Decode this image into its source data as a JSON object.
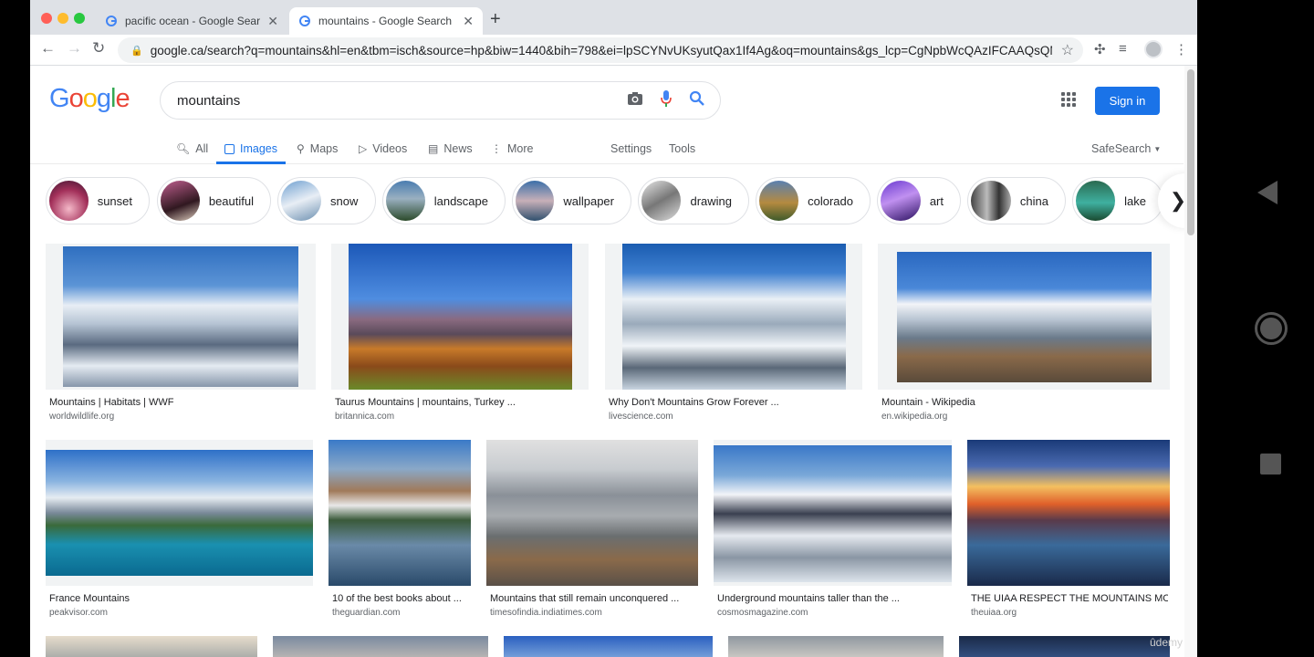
{
  "browser": {
    "tabs": [
      {
        "title": "pacific ocean - Google Search",
        "active": false
      },
      {
        "title": "mountains - Google Search",
        "active": true
      }
    ],
    "url": "google.ca/search?q=mountains&hl=en&tbm=isch&source=hp&biw=1440&bih=798&ei=lpSCYNvUKsyutQax1If4Ag&oq=mountains&gs_lcp=CgNpbWcQAzIFCAAQsQMyBQg..."
  },
  "google": {
    "logo": "Google",
    "query": "mountains",
    "signin_label": "Sign in",
    "nav": {
      "all": "All",
      "images": "Images",
      "maps": "Maps",
      "videos": "Videos",
      "news": "News",
      "more": "More",
      "settings": "Settings",
      "tools": "Tools",
      "safesearch": "SafeSearch"
    },
    "chips": [
      "sunset",
      "beautiful",
      "snow",
      "landscape",
      "wallpaper",
      "drawing",
      "colorado",
      "art",
      "china",
      "lake"
    ],
    "results": [
      {
        "title": "Mountains | Habitats | WWF",
        "source": "worldwildlife.org"
      },
      {
        "title": "Taurus Mountains | mountains, Turkey ...",
        "source": "britannica.com"
      },
      {
        "title": "Why Don't Mountains Grow Forever ...",
        "source": "livescience.com"
      },
      {
        "title": "Mountain - Wikipedia",
        "source": "en.wikipedia.org"
      },
      {
        "title": "France Mountains",
        "source": "peakvisor.com"
      },
      {
        "title": "10 of the best books about ...",
        "source": "theguardian.com"
      },
      {
        "title": "Mountains that still remain unconquered ...",
        "source": "timesofindia.indiatimes.com"
      },
      {
        "title": "Underground mountains taller than the ...",
        "source": "cosmosmagazine.com"
      },
      {
        "title": "THE UIAA RESPECT THE MOUNTAINS MO...",
        "source": "theuiaa.org"
      }
    ]
  },
  "watermark": "ûdemy",
  "colors": {
    "accent": "#1a73e8",
    "logo": [
      "#4285f4",
      "#ea4335",
      "#fbbc05",
      "#4285f4",
      "#34a853",
      "#ea4335"
    ]
  }
}
